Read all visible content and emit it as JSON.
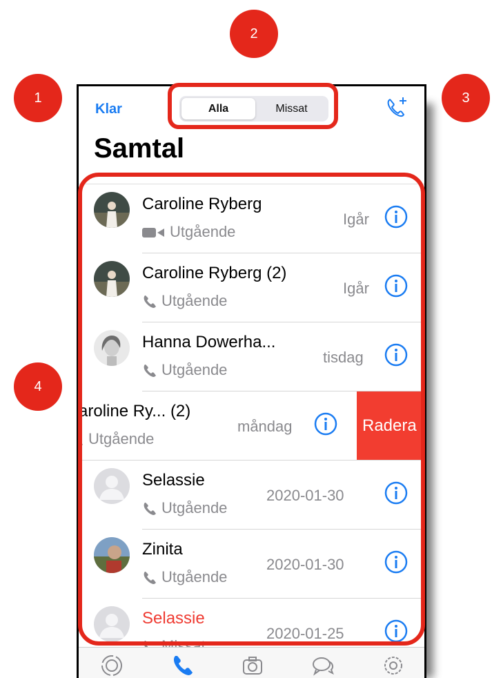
{
  "annotations": [
    "1",
    "2",
    "3",
    "4"
  ],
  "nav": {
    "done_label": "Klar",
    "title": "Samtal"
  },
  "segments": [
    {
      "label": "Alla"
    },
    {
      "label": "Missat"
    }
  ],
  "icons": {
    "new_call": "phone-plus-icon",
    "info": "info-icon",
    "video": "video-icon",
    "phone": "phone-icon"
  },
  "colors": {
    "accent": "#1a7cf2",
    "missed": "#ef3b32",
    "delete": "#f23d30",
    "annotation": "#e4271b"
  },
  "calls": [
    {
      "name": "Caroline Ryberg",
      "type": "Utgående",
      "call_kind": "video",
      "date": "Igår",
      "missed": false
    },
    {
      "name": "Caroline Ryberg  (2)",
      "type": "Utgående",
      "call_kind": "voice",
      "date": "Igår",
      "missed": false
    },
    {
      "name": "Hanna Dowerha...",
      "type": "Utgående",
      "call_kind": "voice",
      "date": "tisdag",
      "missed": false
    },
    {
      "name": "aroline Ry...  (2)",
      "type": "Utgående",
      "call_kind": "voice",
      "date": "måndag",
      "missed": false,
      "delete_label": "Radera"
    },
    {
      "name": "Selassie",
      "type": "Utgående",
      "call_kind": "voice",
      "date": "2020-01-30",
      "missed": false
    },
    {
      "name": "Zinita",
      "type": "Utgående",
      "call_kind": "voice",
      "date": "2020-01-30",
      "missed": false
    },
    {
      "name": "Selassie",
      "type": "Missat",
      "call_kind": "voice",
      "date": "2020-01-25",
      "missed": true
    }
  ],
  "tabbar": [
    {
      "icon": "status-icon",
      "active": false
    },
    {
      "icon": "phone-icon",
      "active": true
    },
    {
      "icon": "camera-icon",
      "active": false
    },
    {
      "icon": "chats-icon",
      "active": false
    },
    {
      "icon": "settings-icon",
      "active": false
    }
  ]
}
